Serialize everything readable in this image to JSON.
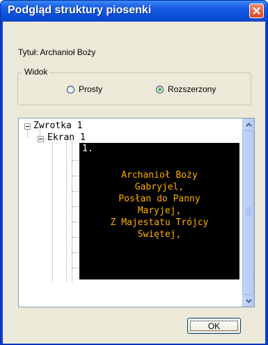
{
  "window": {
    "title": "Podgląd struktury piosenki"
  },
  "song_title": "Tytuł: Archanioł Boży",
  "view": {
    "legend": "Widok",
    "options": [
      {
        "label": "Prosty",
        "checked": false
      },
      {
        "label": "Rozszerzony",
        "checked": true
      }
    ]
  },
  "tree": {
    "verse": "Zwrotka 1",
    "screen": "Ekran 1",
    "preview": {
      "number": "1.",
      "lines": [
        "Archanioł Boży",
        "Gabryjel,",
        "Posłan do Panny",
        "Maryjej,",
        "Z Majestatu Trójcy",
        "Swiętej,"
      ]
    }
  },
  "buttons": {
    "ok": "OK"
  },
  "colors": {
    "titlebar": "#0b4fd8",
    "preview_bg": "#000000",
    "preview_text": "#ffb000",
    "dialog_bg": "#ece9d8"
  }
}
